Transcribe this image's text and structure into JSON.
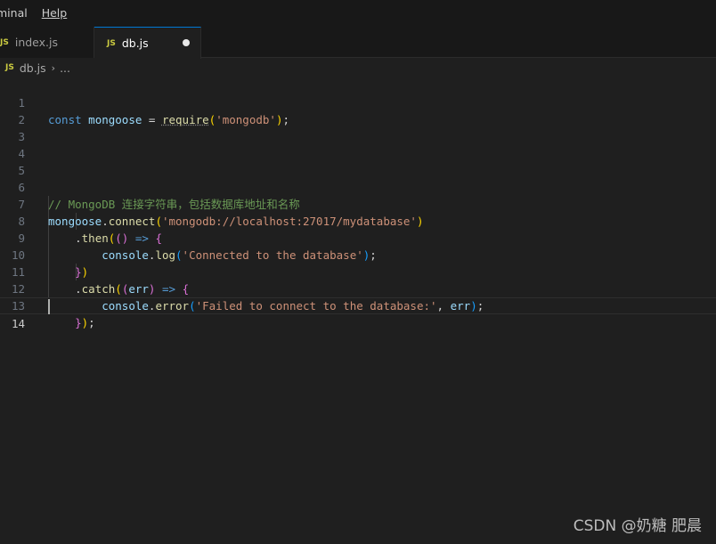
{
  "menu": {
    "items": [
      {
        "label": "minal"
      },
      {
        "label": "Help",
        "underline": "H"
      }
    ]
  },
  "tabs": [
    {
      "icon": "JS",
      "label": "index.js",
      "active": false
    },
    {
      "icon": "JS",
      "label": "db.js",
      "active": true,
      "dirty": true
    }
  ],
  "breadcrumb": {
    "icon": "JS",
    "file": "db.js",
    "separator": "›",
    "more": "..."
  },
  "editor": {
    "current_line": 14,
    "lines": [
      {
        "n": "1"
      },
      {
        "n": "2"
      },
      {
        "n": "3"
      },
      {
        "n": "4"
      },
      {
        "n": "5"
      },
      {
        "n": "6"
      },
      {
        "n": "7"
      },
      {
        "n": "8"
      },
      {
        "n": "9"
      },
      {
        "n": "10"
      },
      {
        "n": "11"
      },
      {
        "n": "12"
      },
      {
        "n": "13"
      },
      {
        "n": "14"
      }
    ],
    "tokens": {
      "l1": {
        "kw": "const",
        "var": "mongoose",
        "op": "=",
        "fn": "require",
        "str": "'mongodb'",
        "end": ";"
      },
      "l6": {
        "comment": "// MongoDB 连接字符串，包括数据库地址和名称"
      },
      "l7": {
        "var": "mongoose",
        "fn": "connect",
        "str": "'mongodb://localhost:27017/mydatabase'"
      },
      "l8": {
        "fn": "then",
        "arrow": "=>"
      },
      "l9": {
        "var": "console",
        "fn": "log",
        "str": "'Connected to the database'"
      },
      "l11": {
        "fn": "catch",
        "param": "err",
        "arrow": "=>"
      },
      "l12": {
        "var": "console",
        "fn": "error",
        "str": "'Failed to connect to the database:'",
        "param": "err"
      }
    }
  },
  "watermark": "CSDN @奶糖 肥晨"
}
